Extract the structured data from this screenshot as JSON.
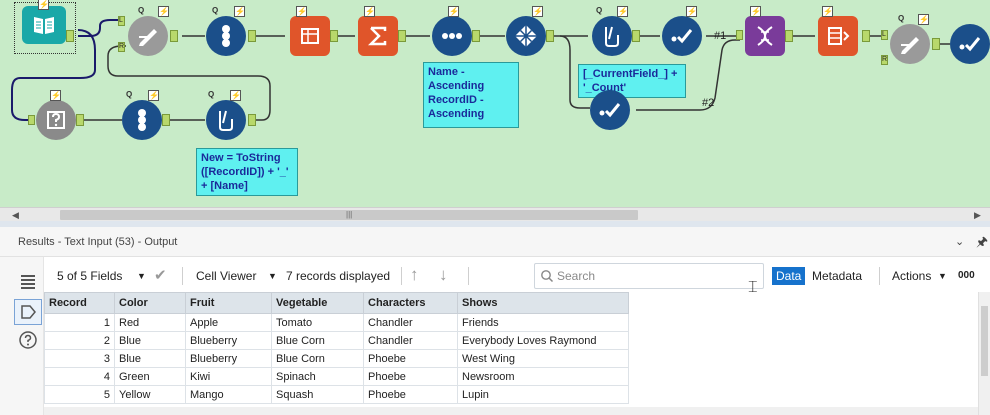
{
  "canvas": {
    "tools": [
      {
        "id": "text-input",
        "icon": "book-icon",
        "color": "#1aa8a8"
      },
      {
        "id": "formula-a",
        "icon": "formula-pen-icon",
        "color": "#9a9a9a"
      },
      {
        "id": "record-id-a",
        "icon": "record-id-icon",
        "color": "#1b4f8a"
      },
      {
        "id": "transpose",
        "icon": "transpose-icon",
        "color": "#e0552a"
      },
      {
        "id": "summarize",
        "icon": "sigma-icon",
        "color": "#e0552a"
      },
      {
        "id": "sort",
        "icon": "sort-dots-icon",
        "color": "#1b4f8a"
      },
      {
        "id": "tile",
        "icon": "tile-icon",
        "color": "#1b4f8a"
      },
      {
        "id": "formula-b",
        "icon": "beaker-icon",
        "color": "#1b4f8a"
      },
      {
        "id": "select-a",
        "icon": "check-icon",
        "color": "#1b4f8a"
      },
      {
        "id": "select-b",
        "icon": "check-icon",
        "color": "#1b4f8a"
      },
      {
        "id": "join-multi",
        "icon": "dna-icon",
        "color": "#7a3b9a"
      },
      {
        "id": "crosstab",
        "icon": "crosstab-icon",
        "color": "#e0552a"
      },
      {
        "id": "formula-c",
        "icon": "formula-pen-icon",
        "color": "#9a9a9a"
      },
      {
        "id": "select-c",
        "icon": "check-icon",
        "color": "#1b4f8a"
      },
      {
        "id": "dynamic-input",
        "icon": "question-icon",
        "color": "#8a8a8a"
      },
      {
        "id": "record-id-b",
        "icon": "record-id-icon",
        "color": "#1b4f8a"
      },
      {
        "id": "formula-d",
        "icon": "beaker-icon",
        "color": "#1b4f8a"
      }
    ],
    "notes": {
      "sort": "Name - Ascending RecordID - Ascending",
      "formula_b": "[_CurrentField_] + '_Count'",
      "formula_d": "New = ToString ([RecordID]) + '_' + [Name]"
    },
    "connection_labels": [
      "#1",
      "#2"
    ],
    "anchor_labels": {
      "left": "L",
      "right": "R"
    },
    "badge_q": "Q",
    "badge_bolt": "⚡"
  },
  "results": {
    "title": "Results - Text Input (53) - Output",
    "toolbar": {
      "fields_label": "5 of 5 Fields",
      "viewer_label": "Cell Viewer",
      "records_label": "7 records displayed",
      "search_placeholder": "Search",
      "tab_data": "Data",
      "tab_metadata": "Metadata",
      "actions_label": "Actions",
      "binary_label": "000"
    },
    "table": {
      "columns": [
        "Record",
        "Color",
        "Fruit",
        "Vegetable",
        "Characters",
        "Shows"
      ],
      "rows": [
        [
          "1",
          "Red",
          "Apple",
          "Tomato",
          "Chandler",
          "Friends"
        ],
        [
          "2",
          "Blue",
          "Blueberry",
          "Blue Corn",
          "Chandler",
          "Everybody Loves Raymond"
        ],
        [
          "3",
          "Blue",
          "Blueberry",
          "Blue Corn",
          "Phoebe",
          "West Wing"
        ],
        [
          "4",
          "Green",
          "Kiwi",
          "Spinach",
          "Phoebe",
          "Newsroom"
        ],
        [
          "5",
          "Yellow",
          "Mango",
          "Squash",
          "Phoebe",
          "Lupin"
        ]
      ]
    }
  }
}
